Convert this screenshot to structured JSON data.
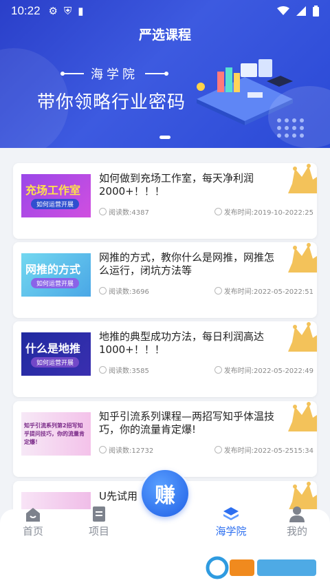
{
  "status_bar": {
    "time": "10:22"
  },
  "header": {
    "title": "严选课程",
    "academy": "海学院",
    "slogan": "带你领略行业密码"
  },
  "courses": [
    {
      "thumb_title": "充场工作室",
      "thumb_pill": "如何运营开展",
      "title": "如何做到充场工作室，每天净利润2000+！！！",
      "reads": "阅读数:4387",
      "date": "发布时间:2019-10-2022:25"
    },
    {
      "thumb_title": "网推的方式",
      "thumb_pill": "如何运营开展",
      "title": "网推的方式，教你什么是网推，网推怎么运行，闭坑方法等",
      "reads": "阅读数:3696",
      "date": "发布时间:2022-05-2022:51"
    },
    {
      "thumb_title": "什么是地推",
      "thumb_pill": "如何运营开展",
      "title": "地推的典型成功方法，每日利润高达1000+！！！",
      "reads": "阅读数:3585",
      "date": "发布时间:2022-05-2022:49"
    },
    {
      "thumb_title": "知乎引流系列第2招写知乎提问技巧，你的流量肯定爆！",
      "title": "知乎引流系列课程—两招写知乎体温技巧，你的流量肯定爆!",
      "reads": "阅读数:12732",
      "date": "发布时间:2022-05-2515:34"
    },
    {
      "title": "U先试用"
    }
  ],
  "tabs": {
    "home": "首页",
    "projects": "项目",
    "earn": "赚",
    "academy": "海学院",
    "mine": "我的"
  },
  "colors": {
    "accent": "#2d6ff0",
    "header": "#2f4ad6",
    "crown": "#f3c25a"
  }
}
